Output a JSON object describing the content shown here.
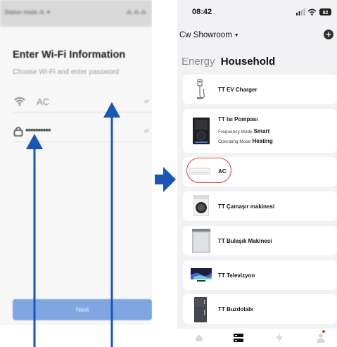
{
  "left_screen": {
    "status_left": "Station mode ⁂ ✦",
    "status_right": "⁂ ⁂ ⁂",
    "title": "Enter Wi-Fi Information",
    "subtitle": "Choose Wi-Fi and enter password",
    "network_value": "AC",
    "password_value": "••••••••••",
    "next_label": "Next"
  },
  "right_screen": {
    "time": "08:42",
    "battery": "82",
    "home_name": "Cw Showroom",
    "tabs": [
      {
        "label": "Energy",
        "active": false
      },
      {
        "label": "Household",
        "active": true
      }
    ],
    "devices": [
      {
        "name": "TT EV Charger",
        "icon": "ev-charger-icon"
      },
      {
        "name": "TT Isı Pompası",
        "icon": "heat-pump-icon",
        "meta": [
          {
            "label": "Frequency Mode",
            "value": "Smart"
          },
          {
            "label": "Operating Mode",
            "value": "Heating"
          }
        ]
      },
      {
        "name": "AC",
        "icon": "air-conditioner-icon"
      },
      {
        "name": "TT Çamaşır makinesi",
        "icon": "washing-machine-icon"
      },
      {
        "name": "TT Bulaşık Makinesi",
        "icon": "dishwasher-icon"
      },
      {
        "name": "TT Televizyon",
        "icon": "television-icon"
      },
      {
        "name": "TT Buzdolabı",
        "icon": "refrigerator-icon"
      }
    ],
    "nav": [
      "home-icon",
      "devices-icon",
      "energy-icon",
      "profile-icon"
    ]
  },
  "colors": {
    "arrow_blue": "#1b55b5",
    "highlight_red": "#e03b3b",
    "next_button": "#7fa6e0"
  }
}
